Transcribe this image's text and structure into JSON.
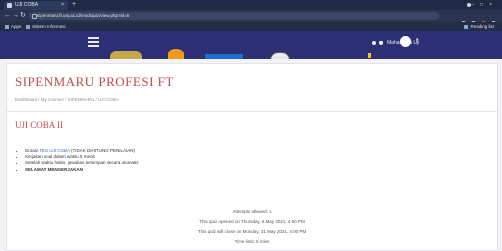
{
  "browser": {
    "tab_title": "UJI COBA",
    "url": "sipenmaru.ft.unj.ac.id/mod/quiz/view.php?id=6",
    "bookmarks": {
      "apps": "Apps",
      "item1": "Sistem Informasi",
      "reading_list": "Reading list"
    }
  },
  "site": {
    "user_name": "Mahasiswa Uji"
  },
  "page": {
    "title": "SIPENMARU PROFESI FT",
    "breadcrumb": "Dashboard / My courses / SIPENMARU / UJI COBA",
    "quiz_title": "UJI COBA II",
    "rules": [
      {
        "text_a": "Durasi ",
        "link": "TES UJI COBA",
        "text_b": " (TIDAK DIHITUNG PENILAIAN)"
      },
      {
        "text": "Kerjakan soal dalam waktu 5 menit"
      },
      {
        "text": "Setelah waktu habis, jawaban tersimpan secara otomatis"
      },
      {
        "text": "SELAMAT MENGERJAKAN",
        "bold": true
      }
    ],
    "summary": {
      "attempts": "Attempts allowed: 1",
      "opened": "This quiz opened on Thursday, 6 May 2021, 4:00 PM",
      "closes": "This quiz will close on Monday, 31 May 2021, 4:00 PM",
      "time_limit": "Time limit: 5 mins"
    }
  },
  "colors": {
    "header_bg": "#2d2f74",
    "title_red": "#c2494a",
    "link_blue": "#2d6fc0"
  }
}
